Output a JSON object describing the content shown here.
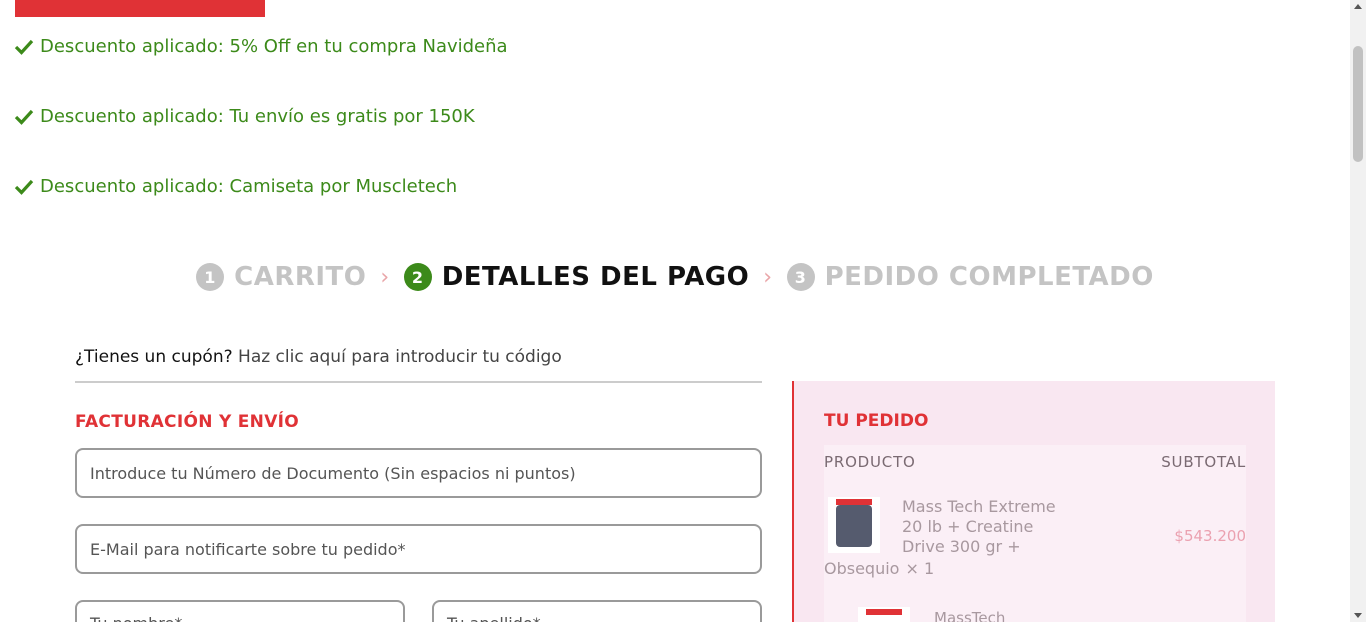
{
  "colors": {
    "accent": "#e03236",
    "success": "#3c8a1a",
    "muted": "#c4c4c4",
    "order_bg": "#f9e7f1"
  },
  "notices": [
    "Descuento aplicado: 5% Off en tu compra Navideña",
    "Descuento aplicado: Tu envío es gratis por 150K",
    "Descuento aplicado: Camiseta por Muscletech"
  ],
  "steps": [
    {
      "num": "1",
      "label": "CARRITO"
    },
    {
      "num": "2",
      "label": "DETALLES DEL PAGO"
    },
    {
      "num": "3",
      "label": "PEDIDO COMPLETADO"
    }
  ],
  "coupon": {
    "question": "¿Tienes un cupón?",
    "link": "Haz clic aquí para introducir tu código"
  },
  "billing": {
    "title": "FACTURACIÓN Y ENVÍO",
    "doc_placeholder": "Introduce tu Número de Documento (Sin espacios ni puntos)",
    "email_placeholder": "E-Mail para notificarte sobre tu pedido*",
    "name_placeholder": "Tu nombre*",
    "lastname_placeholder": "Tu apellido*"
  },
  "order": {
    "title": "TU PEDIDO",
    "col_product": "PRODUCTO",
    "col_subtotal": "SUBTOTAL",
    "items": [
      {
        "name_lines": "Mass Tech Extreme 20 lb + Creatine Drive 300 gr +",
        "name_tail": "Obsequio",
        "qty": "× 1",
        "price": "$543.200"
      },
      {
        "name_lines": "MassTech"
      }
    ]
  }
}
